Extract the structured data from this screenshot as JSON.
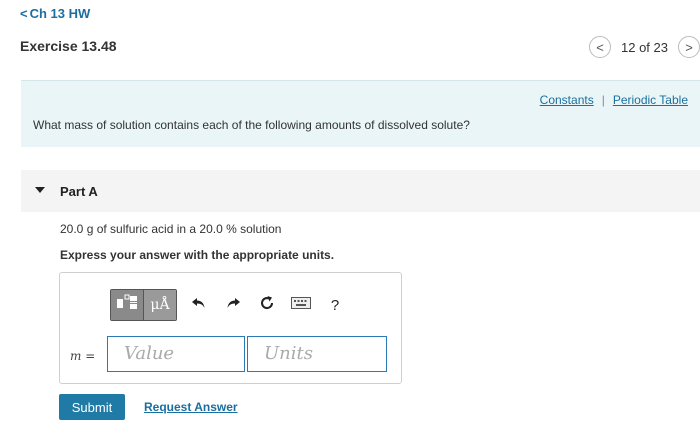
{
  "nav": {
    "back_chevron": "<",
    "back_label": "Ch 13 HW"
  },
  "exercise": {
    "title": "Exercise 13.48"
  },
  "pager": {
    "prev_icon": "<",
    "next_icon": ">",
    "position": "12 of 23"
  },
  "info": {
    "links": [
      "Constants",
      "Periodic Table"
    ],
    "separator": "|",
    "question": "What mass of solution contains each of the following amounts of dissolved solute?"
  },
  "part": {
    "label": "Part A",
    "problem": "20.0 g of sulfuric acid in a 20.0 % solution",
    "instruction": "Express your answer with the appropriate units."
  },
  "toolbar": {
    "units_button_label": "μÅ",
    "help_label": "?",
    "icons": [
      "template-icon",
      "units-icon",
      "undo-icon",
      "redo-icon",
      "reset-icon",
      "keyboard-icon",
      "help-icon"
    ]
  },
  "answer": {
    "variable_label": "m =",
    "value_placeholder": "Value",
    "units_placeholder": "Units"
  },
  "actions": {
    "submit_label": "Submit",
    "request_label": "Request Answer"
  },
  "colors": {
    "accent": "#1f7aa6",
    "link": "#1a6fa0",
    "info_band": "#e9f5f7",
    "part_band": "#f4f4f4"
  }
}
